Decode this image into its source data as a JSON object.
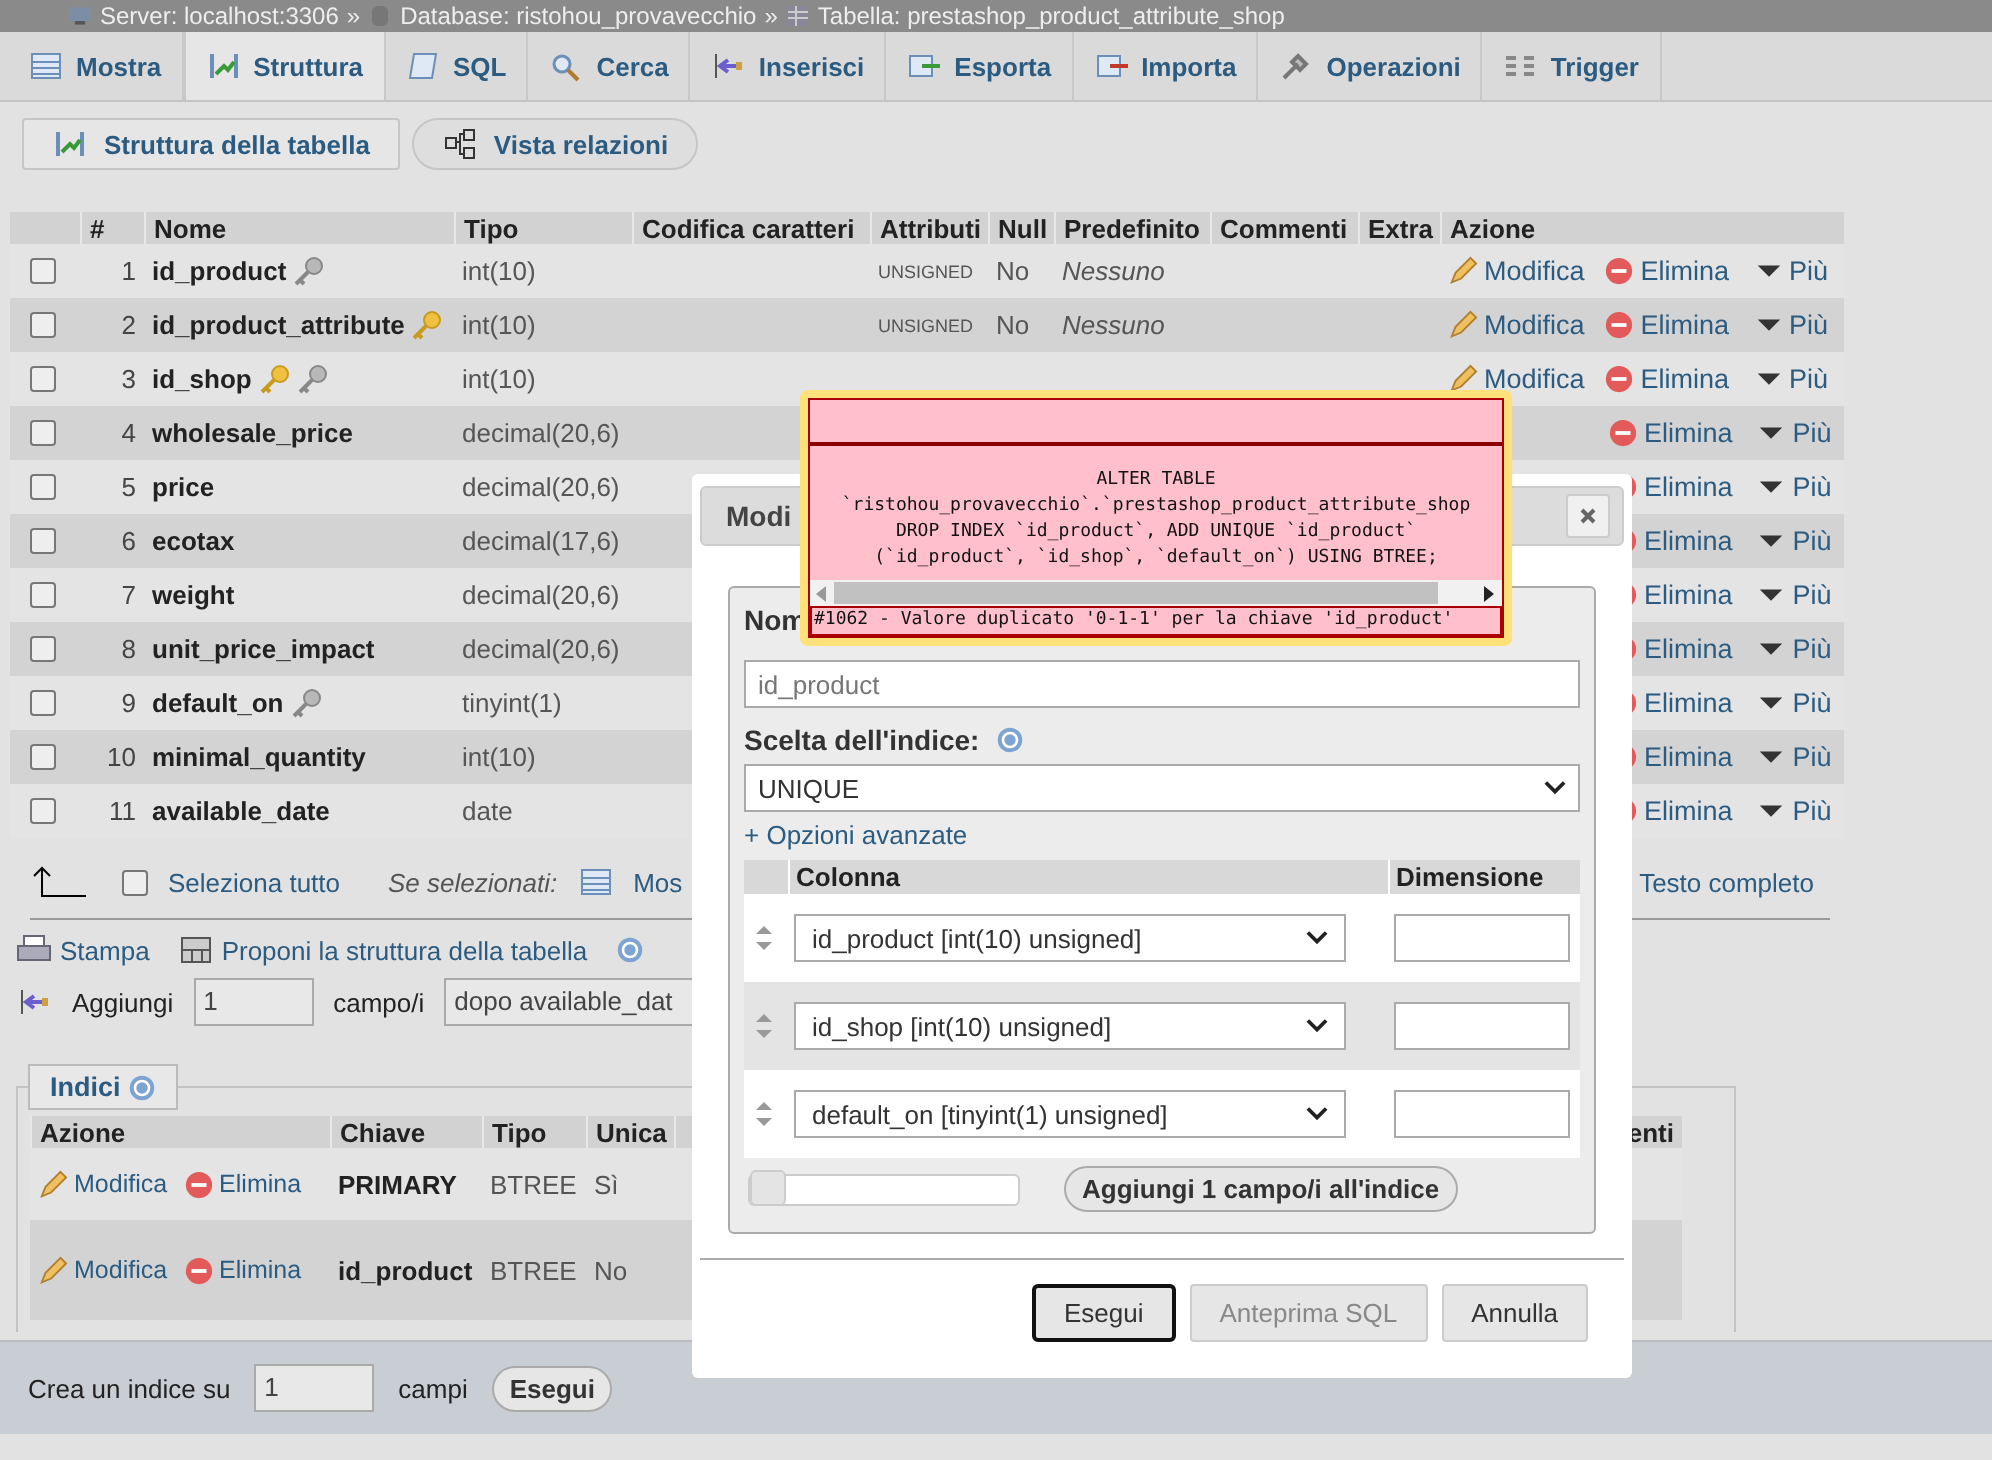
{
  "breadcrumb": {
    "separator": "»",
    "items": [
      {
        "kind": "server",
        "text": "Server: localhost:3306"
      },
      {
        "kind": "database",
        "text": "Database: ristohou_provavecchio"
      },
      {
        "kind": "table",
        "text": "Tabella: prestashop_product_attribute_shop"
      }
    ]
  },
  "tabs": [
    {
      "label": "Mostra",
      "selected": false
    },
    {
      "label": "Struttura",
      "selected": true
    },
    {
      "label": "SQL",
      "selected": false
    },
    {
      "label": "Cerca",
      "selected": false
    },
    {
      "label": "Inserisci",
      "selected": false
    },
    {
      "label": "Esporta",
      "selected": false
    },
    {
      "label": "Importa",
      "selected": false
    },
    {
      "label": "Operazioni",
      "selected": false
    },
    {
      "label": "Trigger",
      "selected": false
    }
  ],
  "subtabs": [
    {
      "label": "Struttura della tabella",
      "selected": true
    },
    {
      "label": "Vista relazioni",
      "selected": false
    }
  ],
  "structure": {
    "headers": [
      "#",
      "Nome",
      "Tipo",
      "Codifica caratteri",
      "Attributi",
      "Null",
      "Predefinito",
      "Commenti",
      "Extra",
      "Azione"
    ],
    "rows": [
      {
        "num": "1",
        "name": "id_product",
        "keys": [
          {
            "kind": "index"
          }
        ],
        "type": "int(10)",
        "attributes": "UNSIGNED",
        "null": "No",
        "default": "Nessuno",
        "checked": false,
        "actions": [
          {
            "kind": "edit",
            "label": "Modifica"
          },
          {
            "kind": "drop",
            "label": "Elimina"
          },
          {
            "kind": "more",
            "label": "Più"
          }
        ]
      },
      {
        "num": "2",
        "name": "id_product_attribute",
        "keys": [
          {
            "kind": "primary"
          }
        ],
        "type": "int(10)",
        "attributes": "UNSIGNED",
        "null": "No",
        "default": "Nessuno",
        "checked": false,
        "actions": [
          {
            "kind": "edit",
            "label": "Modifica"
          },
          {
            "kind": "drop",
            "label": "Elimina"
          },
          {
            "kind": "more",
            "label": "Più"
          }
        ]
      },
      {
        "num": "3",
        "name": "id_shop",
        "keys": [
          {
            "kind": "primary"
          },
          {
            "kind": "index"
          }
        ],
        "type": "int(10)",
        "checked": false,
        "actions": [
          {
            "kind": "edit",
            "label": "Modifica"
          },
          {
            "kind": "drop",
            "label": "Elimina"
          },
          {
            "kind": "more",
            "label": "Più"
          }
        ]
      },
      {
        "num": "4",
        "name": "wholesale_price",
        "keys": [],
        "type": "decimal(20,6)",
        "checked": false,
        "actions": [
          {
            "kind": "drop",
            "label": "Elimina"
          },
          {
            "kind": "more",
            "label": "Più"
          }
        ]
      },
      {
        "num": "5",
        "name": "price",
        "keys": [],
        "type": "decimal(20,6)",
        "checked": false,
        "actions": [
          {
            "kind": "drop",
            "label": "Elimina"
          },
          {
            "kind": "more",
            "label": "Più"
          }
        ]
      },
      {
        "num": "6",
        "name": "ecotax",
        "keys": [],
        "type": "decimal(17,6)",
        "checked": false,
        "actions": [
          {
            "kind": "drop",
            "label": "Elimina"
          },
          {
            "kind": "more",
            "label": "Più"
          }
        ]
      },
      {
        "num": "7",
        "name": "weight",
        "keys": [],
        "type": "decimal(20,6)",
        "checked": false,
        "actions": [
          {
            "kind": "drop",
            "label": "Elimina"
          },
          {
            "kind": "more",
            "label": "Più"
          }
        ]
      },
      {
        "num": "8",
        "name": "unit_price_impact",
        "keys": [],
        "type": "decimal(20,6)",
        "checked": false,
        "actions": [
          {
            "kind": "drop",
            "label": "Elimina"
          },
          {
            "kind": "more",
            "label": "Più"
          }
        ]
      },
      {
        "num": "9",
        "name": "default_on",
        "keys": [
          {
            "kind": "index"
          }
        ],
        "type": "tinyint(1)",
        "checked": false,
        "actions": [
          {
            "kind": "drop",
            "label": "Elimina"
          },
          {
            "kind": "more",
            "label": "Più"
          }
        ]
      },
      {
        "num": "10",
        "name": "minimal_quantity",
        "keys": [],
        "type": "int(10)",
        "checked": false,
        "actions": [
          {
            "kind": "drop",
            "label": "Elimina"
          },
          {
            "kind": "more",
            "label": "Più"
          }
        ]
      },
      {
        "num": "11",
        "name": "available_date",
        "keys": [],
        "type": "date",
        "checked": false,
        "actions": [
          {
            "kind": "drop",
            "label": "Elimina"
          },
          {
            "kind": "more",
            "label": "Più"
          }
        ]
      }
    ]
  },
  "bulk": {
    "select_all": "Seleziona tutto",
    "checked": false,
    "with_selected": "Se selezionati:",
    "browse": "Mos",
    "fulltext": "Testo completo"
  },
  "tools": {
    "print": "Stampa",
    "propose": "Proponi la struttura della tabella"
  },
  "add_columns": {
    "label": "Aggiungi",
    "count": "1",
    "unit": "campo/i",
    "position": "dopo available_dat"
  },
  "indexes": {
    "legend": "Indici",
    "headers": [
      "Azione",
      "Chiave",
      "Tipo",
      "Unica",
      "enti"
    ],
    "rows": [
      {
        "actions": [
          {
            "kind": "edit",
            "label": "Modifica"
          },
          {
            "kind": "drop",
            "label": "Elimina"
          }
        ],
        "key": "PRIMARY",
        "type": "BTREE",
        "unique": "Sì"
      },
      {
        "actions": [
          {
            "kind": "edit",
            "label": "Modifica"
          },
          {
            "kind": "drop",
            "label": "Elimina"
          }
        ],
        "key": "id_product",
        "type": "BTREE",
        "unique": "No"
      }
    ]
  },
  "create_index": {
    "label": "Crea un indice su",
    "count": "1",
    "unit": "campi",
    "button": "Esegui"
  },
  "dialog": {
    "title": "Modi",
    "name_label": "Nom",
    "name_value": "id_product",
    "choice_label": "Scelta dell'indice:",
    "choice": "UNIQUE",
    "advanced": "+ Opzioni avanzate",
    "headers": [
      "Colonna",
      "Dimensione"
    ],
    "columns": [
      {
        "value": "id_product [int(10) unsigned]"
      },
      {
        "value": "id_shop [int(10) unsigned]"
      },
      {
        "value": "default_on [tinyint(1) unsigned]"
      }
    ],
    "slider": {
      "level": 0
    },
    "add_button": "Aggiungi 1 campo/i all'indice",
    "buttons": [
      {
        "label": "Esegui",
        "disabled": false
      },
      {
        "label": "Anteprima SQL",
        "disabled": true
      },
      {
        "label": "Annulla",
        "disabled": false
      }
    ]
  },
  "error": {
    "sql": [
      "ALTER TABLE",
      "`ristohou_provavecchio`.`prestashop_product_attribute_shop",
      "DROP INDEX `id_product`, ADD UNIQUE `id_product`",
      "(`id_product`, `id_shop`, `default_on`) USING BTREE;"
    ],
    "message": "#1062 - Valore duplicato '0-1-1' per la chiave 'id_product'"
  }
}
